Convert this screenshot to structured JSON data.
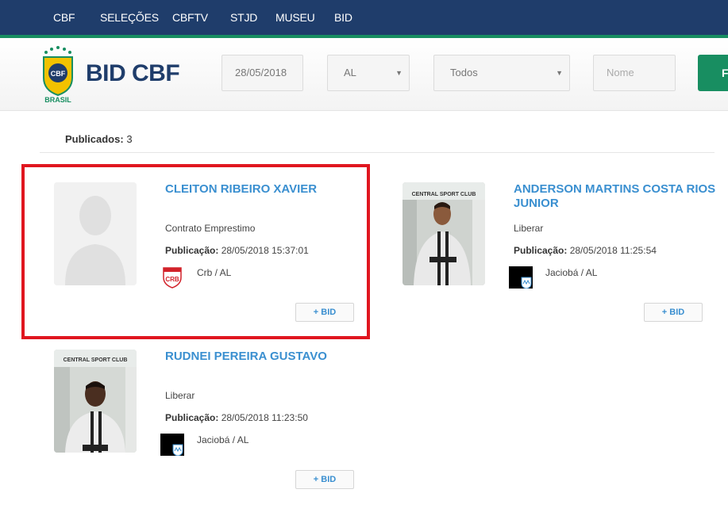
{
  "topnav": {
    "items": [
      "CBF",
      "SELEÇÕES",
      "CBFTV",
      "STJD",
      "MUSEU",
      "BID"
    ]
  },
  "header": {
    "logo_text": "CBF",
    "logo_caption": "BRASIL",
    "brand": "BID CBF",
    "date_value": "28/05/2018",
    "state_value": "AL",
    "type_value": "Todos",
    "name_placeholder": "Nome",
    "submit_label": "F"
  },
  "published": {
    "label": "Publicados:",
    "count": "3"
  },
  "athletes": [
    {
      "name": "CLEITON RIBEIRO XAVIER",
      "contract": "Contrato Emprestimo",
      "pub_label": "Publicação:",
      "pub_value": "28/05/2018 15:37:01",
      "club": "Crb / AL",
      "club_crest_text": "CRB",
      "bid_label": "+ BID"
    },
    {
      "name": "ANDERSON MARTINS COSTA RIOS JUNIOR",
      "contract": "Liberar",
      "pub_label": "Publicação:",
      "pub_value": "28/05/2018 11:25:54",
      "club": "Jaciobá / AL",
      "bid_label": "+ BID",
      "photo_sign": "CENTRAL SPORT CLUB"
    },
    {
      "name": "RUDNEI PEREIRA GUSTAVO",
      "contract": "Liberar",
      "pub_label": "Publicação:",
      "pub_value": "28/05/2018 11:23:50",
      "club": "Jaciobá / AL",
      "bid_label": "+ BID",
      "photo_sign": "CENTRAL SPORT CLUB"
    }
  ],
  "colors": {
    "nav_bg": "#1f3d6b",
    "accent_green": "#188e61",
    "link_blue": "#3a8fd0",
    "highlight_red": "#e0161f"
  }
}
